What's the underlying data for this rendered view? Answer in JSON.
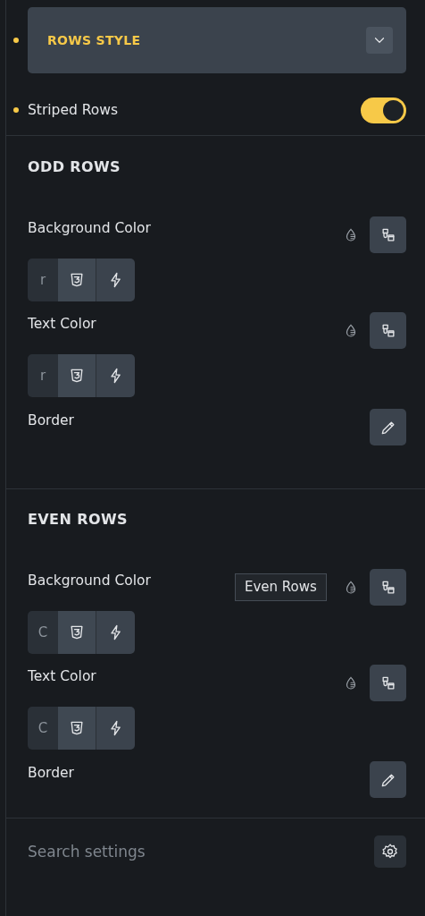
{
  "group_header": {
    "title": "ROWS STYLE",
    "expanded": false,
    "modified": true
  },
  "striped_rows": {
    "label": "Striped Rows",
    "on": true,
    "modified": true
  },
  "sections": [
    {
      "title": "ODD ROWS",
      "controls": [
        {
          "kind": "color",
          "label": "Background Color",
          "value": "r"
        },
        {
          "kind": "color",
          "label": "Text Color",
          "value": "r"
        },
        {
          "kind": "border",
          "label": "Border"
        }
      ]
    },
    {
      "title": "EVEN ROWS",
      "controls": [
        {
          "kind": "color",
          "label": "Background Color",
          "value": "C"
        },
        {
          "kind": "color",
          "label": "Text Color",
          "value": "C"
        },
        {
          "kind": "border",
          "label": "Border"
        }
      ]
    }
  ],
  "tooltip": {
    "text": "Even Rows"
  },
  "search": {
    "placeholder": "Search settings"
  }
}
